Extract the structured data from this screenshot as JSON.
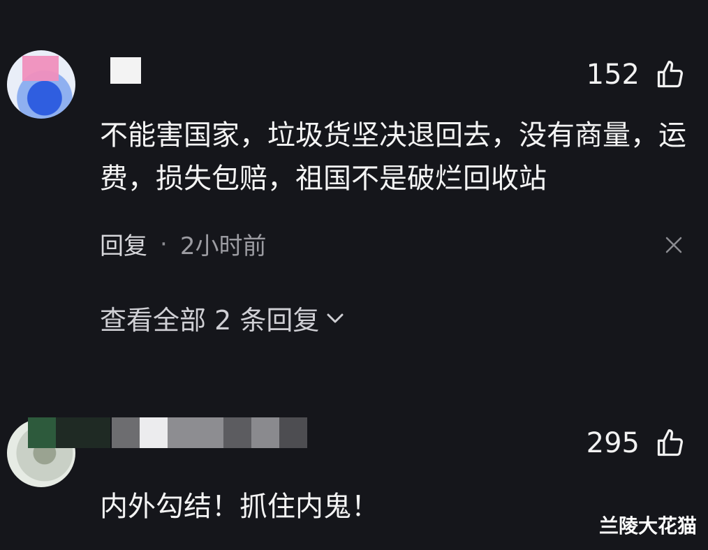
{
  "comments": [
    {
      "likes": "152",
      "text": "不能害国家，垃圾货坚决退回去，没有商量，运费，损失包赔，祖国不是破烂回收站",
      "reply_label": "回复",
      "separator": "·",
      "time": "2小时前",
      "view_replies": "查看全部 2 条回复"
    },
    {
      "likes": "295",
      "text": "内外勾结！抓住内鬼！"
    }
  ],
  "watermark": "兰陵大花猫",
  "colors": {
    "background": "#15161b",
    "text": "#f2f2f2",
    "muted": "#9c9ca2"
  },
  "icons": {
    "like": "thumb-up-icon",
    "close": "close-icon",
    "expand": "chevron-down-icon"
  }
}
